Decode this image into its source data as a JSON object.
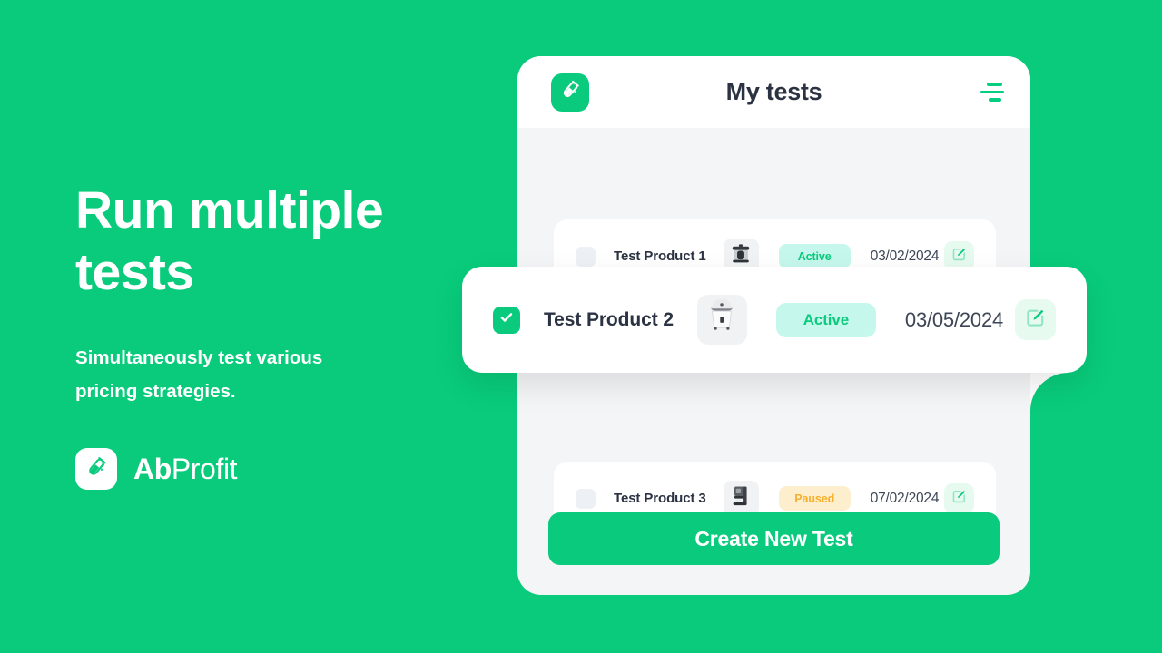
{
  "promo": {
    "headline": "Run multiple tests",
    "subtitle": "Simultaneously test various pricing strategies.",
    "brand_strong": "Ab",
    "brand_light": "Profit",
    "brand_icon": "test-tube-icon"
  },
  "app": {
    "title": "My tests",
    "logo_icon": "test-tube-icon",
    "menu_icon": "hamburger-menu-icon"
  },
  "tests": [
    {
      "name": "Test Product 1",
      "checked": false,
      "thumbnail_icon": "pressure-cooker-icon",
      "status": "Active",
      "status_kind": "active",
      "date": "03/02/2024",
      "edit_icon": "edit-pencil-icon"
    },
    {
      "name": "Test Product 2",
      "checked": true,
      "thumbnail_icon": "rice-cooker-icon",
      "status": "Active",
      "status_kind": "active",
      "date": "03/05/2024",
      "edit_icon": "edit-pencil-icon"
    },
    {
      "name": "Test Product 3",
      "checked": false,
      "thumbnail_icon": "espresso-machine-icon",
      "status": "Paused",
      "status_kind": "paused",
      "date": "07/02/2024",
      "edit_icon": "edit-pencil-icon"
    }
  ],
  "cta": {
    "label": "Create New Test"
  },
  "colors": {
    "background_green": "#09CB7B",
    "brand_green": "#0ACB7D",
    "active_badge_bg": "#C6F7EC",
    "active_badge_text": "#0ACB7D",
    "paused_badge_bg": "#FDEFCE",
    "paused_badge_text": "#F5B02E",
    "text_dark": "#2B3241",
    "phone_bg": "#F4F5F6"
  }
}
